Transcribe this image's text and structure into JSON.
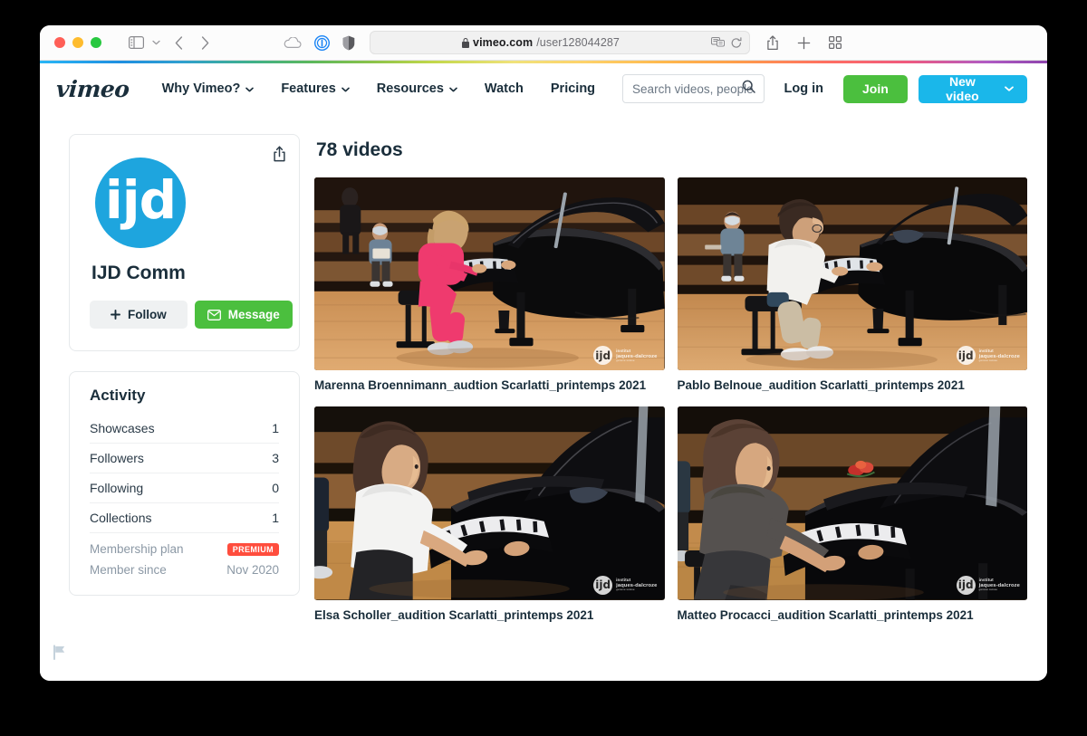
{
  "browser": {
    "url_domain": "vimeo.com",
    "url_path": "/user128044287",
    "lock_icon": "lock-icon",
    "sidebar_toggle_icon": "sidebar-toggle-icon",
    "sidebar_chevron_icon": "chevron-down-icon",
    "back_icon": "chevron-left-icon",
    "forward_icon": "chevron-right-icon",
    "cloud_icon": "icloud-icon",
    "pip_icon": "picture-in-picture-icon",
    "shield_icon": "privacy-shield-icon",
    "reader_icon": "reader-view-icon",
    "reload_icon": "reload-icon",
    "share_icon": "share-icon",
    "new_tab_icon": "plus-icon",
    "tab_overview_icon": "tab-overview-icon"
  },
  "header": {
    "logo": "vimeo",
    "nav": [
      {
        "label": "Why Vimeo?",
        "has_chevron": true
      },
      {
        "label": "Features",
        "has_chevron": true
      },
      {
        "label": "Resources",
        "has_chevron": true
      },
      {
        "label": "Watch",
        "has_chevron": false
      },
      {
        "label": "Pricing",
        "has_chevron": false
      }
    ],
    "search": {
      "placeholder": "Search videos, people, and more",
      "value": "",
      "icon": "search-icon"
    },
    "login_label": "Log in",
    "join_label": "Join",
    "new_video_label": "New video",
    "new_video_chevron": "⌄"
  },
  "sidebar": {
    "profile": {
      "share_button_icon": "share-icon",
      "avatar_initials": "ijd",
      "avatar_color": "#1ea5de",
      "name": "IJD Comm",
      "follow_label": "Follow",
      "follow_icon": "plus-icon",
      "message_label": "Message",
      "message_icon": "envelope-icon"
    },
    "activity": {
      "title": "Activity",
      "rows": [
        {
          "label": "Showcases",
          "value": "1"
        },
        {
          "label": "Followers",
          "value": "3"
        },
        {
          "label": "Following",
          "value": "0"
        },
        {
          "label": "Collections",
          "value": "1"
        }
      ],
      "membership_plan_label": "Membership plan",
      "membership_plan_badge": "PREMIUM",
      "member_since_label": "Member since",
      "member_since_value": "Nov 2020"
    }
  },
  "main": {
    "heading": "78 videos",
    "videos": [
      {
        "title": "Marenna Broennimann_audtion Scarlatti_printemps 2021",
        "watermark": {
          "mark": "ijd",
          "line1": "institut",
          "line2": "jaques-dalcroze",
          "line3": "geneve suisse"
        },
        "scene": "girl-in-pink-at-grand-piano"
      },
      {
        "title": "Pablo Belnoue_audition Scarlatti_printemps 2021",
        "watermark": {
          "mark": "ijd",
          "line1": "institut",
          "line2": "jaques-dalcroze",
          "line3": "geneve suisse"
        },
        "scene": "boy-in-white-hoodie-at-grand-piano"
      },
      {
        "title": "Elsa Scholler_audition Scarlatti_printemps 2021",
        "watermark": {
          "mark": "ijd",
          "line1": "institut",
          "line2": "jaques-dalcroze",
          "line3": "geneve suisse"
        },
        "scene": "girl-in-white-tshirt-at-grand-piano"
      },
      {
        "title": "Matteo Procacci_audition Scarlatti_printemps 2021",
        "watermark": {
          "mark": "ijd",
          "line1": "institut",
          "line2": "jaques-dalcroze",
          "line3": "geneve suisse"
        },
        "scene": "child-in-grey-sweater-at-grand-piano"
      }
    ],
    "report_flag_icon": "flag-icon"
  },
  "colors": {
    "vimeo_blue": "#1ab7ea",
    "join_green": "#4bbf3e",
    "premium_red": "#ff4d3d",
    "text_dark": "#1a2e3b"
  }
}
